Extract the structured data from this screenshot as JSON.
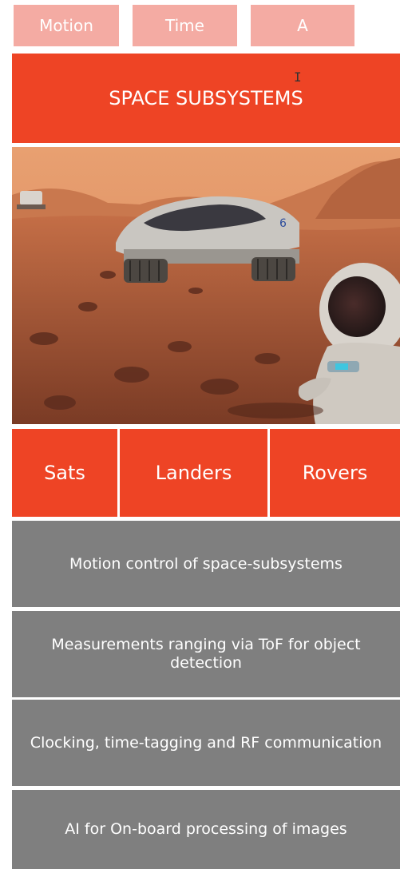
{
  "tabs": [
    {
      "label": "Motion"
    },
    {
      "label": "Time"
    },
    {
      "label": "A"
    }
  ],
  "header": {
    "title": "SPACE SUBSYSTEMS"
  },
  "categories": [
    {
      "label": "Sats"
    },
    {
      "label": "Landers"
    },
    {
      "label": "Rovers"
    }
  ],
  "items": [
    {
      "label": "Motion control of space-subsystems"
    },
    {
      "label": "Measurements ranging via ToF for object detection"
    },
    {
      "label": "Clocking, time-tagging and RF communication"
    },
    {
      "label": "AI for On-board processing of images"
    }
  ],
  "colors": {
    "tab_bg": "#f4aba3",
    "accent": "#ee4425",
    "item_bg": "#7f7f7f"
  }
}
